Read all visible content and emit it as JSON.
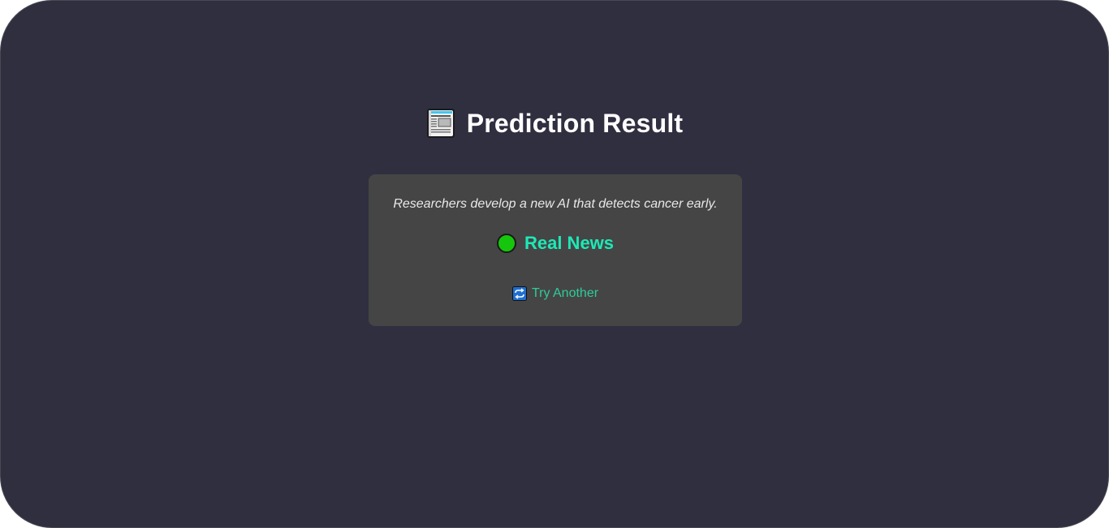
{
  "page": {
    "title": "Prediction Result",
    "title_icon": "newspaper-icon"
  },
  "result": {
    "headline": "Researchers develop a new AI that detects cancer early.",
    "verdict_icon": "green-circle-icon",
    "verdict": "Real News",
    "verdict_color": "#1de9b6",
    "status_color": "#16c60c"
  },
  "actions": {
    "try_another_icon": "refresh-icon",
    "try_another_label": "Try Another",
    "link_color": "#2ecc9a"
  }
}
